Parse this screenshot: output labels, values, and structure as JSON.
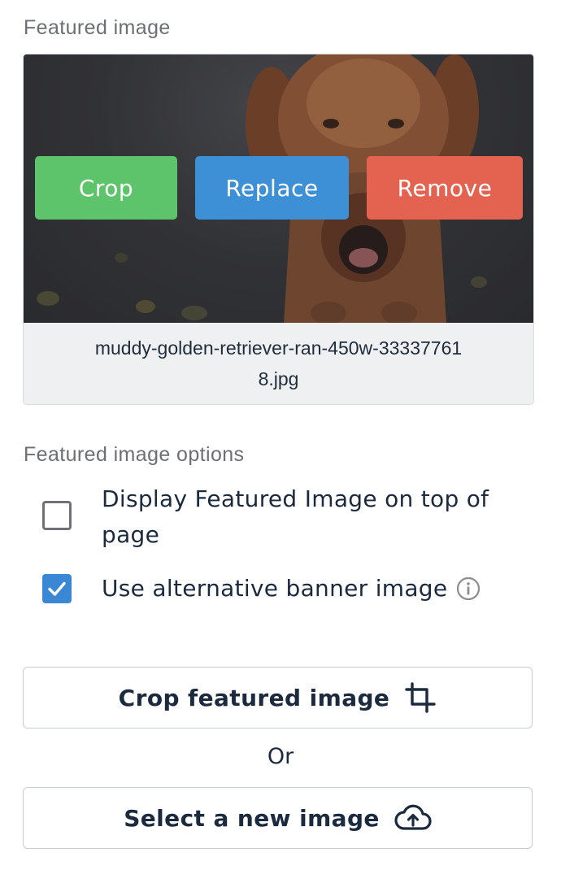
{
  "featured_image": {
    "section_label": "Featured image",
    "crop_label": "Crop",
    "replace_label": "Replace",
    "remove_label": "Remove",
    "filename": "muddy-golden-retriever-ran-450w-333377618.jpg",
    "colors": {
      "crop": "#5ec46b",
      "replace": "#3d8fd6",
      "remove": "#e46250"
    }
  },
  "options": {
    "section_label": "Featured image options",
    "display_on_top": {
      "label": "Display Featured Image on top of page",
      "checked": false
    },
    "alternative_banner": {
      "label": "Use alternative banner image",
      "checked": true
    },
    "info_icon": "info-icon"
  },
  "actions": {
    "crop_featured_label": "Crop featured image",
    "crop_icon": "crop-icon",
    "or_text": "Or",
    "select_new_label": "Select a new image",
    "upload_icon": "cloud-upload-icon"
  }
}
